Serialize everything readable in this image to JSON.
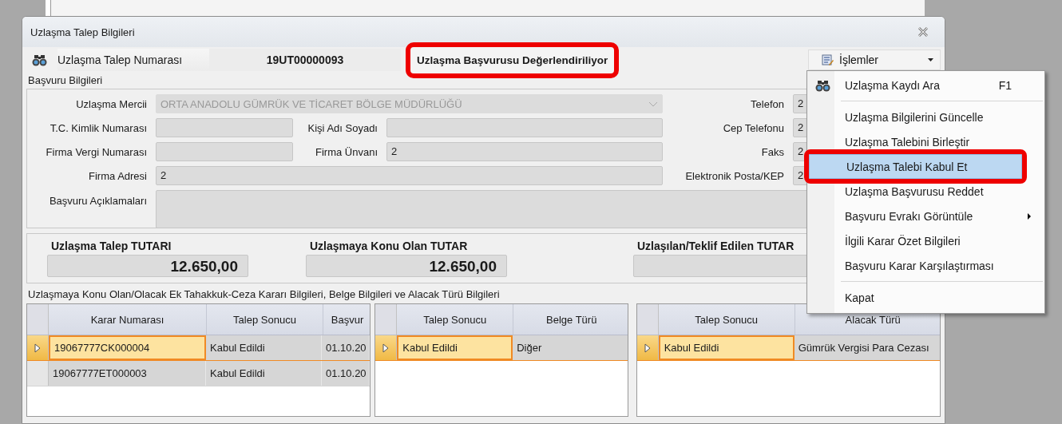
{
  "window": {
    "title": "Uzlaşma Talep Bilgileri"
  },
  "header": {
    "number_label": "Uzlaşma Talep Numarası",
    "number": "19UT00000093",
    "status": "Uzlaşma Başvurusu Değerlendiriliyor",
    "status_highlighted": true,
    "actions_button": "İşlemler"
  },
  "application": {
    "title": "Başvuru Bilgileri",
    "rows": [
      [
        {
          "label": "Uzlaşma Mercii",
          "value": "ORTA ANADOLU GÜMRÜK VE TİCARET BÖLGE MÜDÜRLÜĞÜ",
          "kind": "combo"
        },
        {
          "label": "Telefon",
          "value": "2",
          "kind": "side"
        }
      ],
      [
        {
          "label": "T.C. Kimlik Numarası",
          "kind": "short"
        },
        {
          "label": "Kişi Adı Soyadı",
          "kind": "mid"
        },
        {
          "label": "Cep Telefonu",
          "value": "2",
          "kind": "side"
        }
      ],
      [
        {
          "label": "Firma Vergi Numarası",
          "kind": "short"
        },
        {
          "label": "Firma Ünvanı",
          "value": "2",
          "kind": "mid"
        },
        {
          "label": "Faks",
          "value": "2",
          "kind": "side"
        }
      ],
      [
        {
          "label": "Firma Adresi",
          "value": "2",
          "kind": "wide"
        },
        {
          "label": "Elektronik Posta/KEP",
          "value": "2",
          "kind": "side"
        }
      ],
      [
        {
          "label": "Başvuru Açıklamaları",
          "kind": "area"
        }
      ]
    ]
  },
  "totals": [
    {
      "label": "Uzlaşma Talep TUTARI",
      "value": "12.650,00"
    },
    {
      "label": "Uzlaşmaya Konu Olan TUTAR",
      "value": "12.650,00"
    },
    {
      "label": "Uzlaşılan/Teklif Edilen TUTAR"
    }
  ],
  "details": {
    "caption": "Uzlaşmaya Konu Olan/Olacak Ek Tahakkuk-Ceza Kararı Bilgileri, Belge Bilgileri ve Alacak Türü Bilgileri",
    "tables": [
      {
        "columns": [
          "Karar Numarası",
          "Talep Sonucu",
          "Başvur"
        ],
        "rows": [
          {
            "cells": [
              "19067777CK000004",
              "Kabul Edildi",
              "01.10.20"
            ],
            "selected": true
          },
          {
            "cells": [
              "19067777ET000003",
              "Kabul Edildi",
              "01.10.20"
            ],
            "selected": false
          }
        ]
      },
      {
        "columns": [
          "Talep Sonucu",
          "Belge Türü"
        ],
        "rows": [
          {
            "cells": [
              "Kabul Edildi",
              "Diğer"
            ],
            "selected": true
          }
        ]
      },
      {
        "columns": [
          "Talep Sonucu",
          "Alacak Türü"
        ],
        "rows": [
          {
            "cells": [
              "Kabul Edildi",
              "Gümrük Vergisi Para Cezası"
            ],
            "selected": true
          }
        ]
      }
    ]
  },
  "menu": {
    "items": [
      {
        "kind": "item",
        "label": "Uzlaşma Kaydı Ara",
        "shortcut": "F1",
        "has_icon": true,
        "selected": false,
        "highlighted": false,
        "submenu": false
      },
      {
        "kind": "separator"
      },
      {
        "kind": "item",
        "label": "Uzlaşma Bilgilerini Güncelle",
        "has_icon": false,
        "selected": false,
        "highlighted": false,
        "submenu": false
      },
      {
        "kind": "item",
        "label": "Uzlaşma Talebini Birleştir",
        "has_icon": false,
        "selected": false,
        "highlighted": false,
        "submenu": false
      },
      {
        "kind": "item",
        "label": "Uzlaşma Talebi Kabul Et",
        "has_icon": false,
        "selected": true,
        "highlighted": true,
        "submenu": false
      },
      {
        "kind": "item",
        "label": "Uzlaşma Başvurusu Reddet",
        "has_icon": false,
        "selected": false,
        "highlighted": false,
        "submenu": false
      },
      {
        "kind": "item",
        "label": "Başvuru Evrakı Görüntüle",
        "has_icon": false,
        "selected": false,
        "highlighted": false,
        "submenu": true
      },
      {
        "kind": "item",
        "label": "İlgili Karar Özet Bilgileri",
        "has_icon": false,
        "selected": false,
        "highlighted": false,
        "submenu": false
      },
      {
        "kind": "item",
        "label": "Başvuru Karar Karşılaştırması",
        "has_icon": false,
        "selected": false,
        "highlighted": false,
        "submenu": false
      },
      {
        "kind": "separator"
      },
      {
        "kind": "item",
        "label": "Kapat",
        "has_icon": false,
        "selected": false,
        "highlighted": false,
        "submenu": false
      }
    ]
  }
}
